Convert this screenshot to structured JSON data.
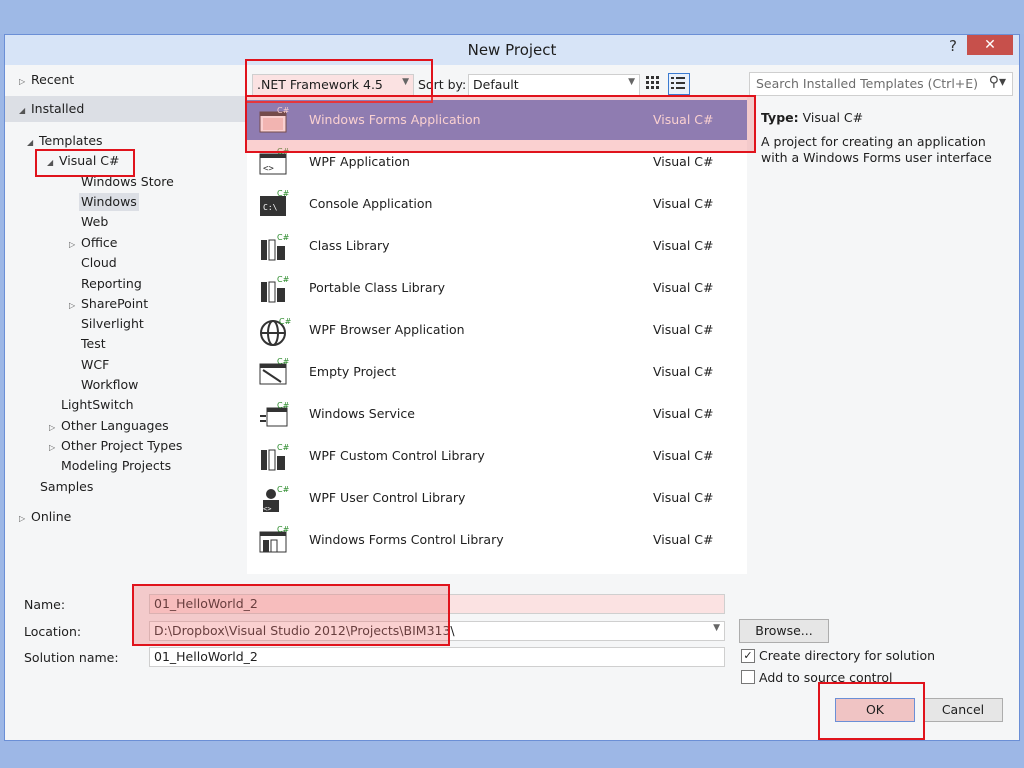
{
  "dialog": {
    "title": "New Project",
    "help": "?",
    "close": "✕"
  },
  "tree": {
    "recent": "Recent",
    "installed": "Installed",
    "templates": "Templates",
    "visual_csharp": "Visual C#",
    "children": [
      "Windows Store",
      "Windows",
      "Web",
      "Office",
      "Cloud",
      "Reporting",
      "SharePoint",
      "Silverlight",
      "Test",
      "WCF",
      "Workflow"
    ],
    "lightswitch": "LightSwitch",
    "other_languages": "Other Languages",
    "other_project_types": "Other Project Types",
    "modeling_projects": "Modeling Projects",
    "samples": "Samples",
    "online": "Online"
  },
  "toolbar": {
    "framework": ".NET Framework 4.5",
    "sort_label": "Sort by:",
    "sort_value": "Default"
  },
  "templates": [
    {
      "name": "Windows Forms Application",
      "lang": "Visual C#",
      "icon": "windows-forms-icon"
    },
    {
      "name": "WPF Application",
      "lang": "Visual C#",
      "icon": "wpf-app-icon"
    },
    {
      "name": "Console Application",
      "lang": "Visual C#",
      "icon": "console-icon"
    },
    {
      "name": "Class Library",
      "lang": "Visual C#",
      "icon": "class-library-icon"
    },
    {
      "name": "Portable Class Library",
      "lang": "Visual C#",
      "icon": "portable-class-library-icon"
    },
    {
      "name": "WPF Browser Application",
      "lang": "Visual C#",
      "icon": "globe-icon"
    },
    {
      "name": "Empty Project",
      "lang": "Visual C#",
      "icon": "empty-project-icon"
    },
    {
      "name": "Windows Service",
      "lang": "Visual C#",
      "icon": "windows-service-icon"
    },
    {
      "name": "WPF Custom Control Library",
      "lang": "Visual C#",
      "icon": "custom-control-icon"
    },
    {
      "name": "WPF User Control Library",
      "lang": "Visual C#",
      "icon": "user-control-icon"
    },
    {
      "name": "Windows Forms Control Library",
      "lang": "Visual C#",
      "icon": "forms-control-icon"
    }
  ],
  "search": {
    "placeholder": "Search Installed Templates (Ctrl+E)"
  },
  "details": {
    "type_label": "Type:",
    "type_value": "Visual C#",
    "description": "A project for creating an application with a Windows Forms user interface"
  },
  "form": {
    "name_label": "Name:",
    "name_value": "01_HelloWorld_2",
    "location_label": "Location:",
    "location_value": "D:\\Dropbox\\Visual Studio 2012\\Projects\\BIM313\\",
    "solution_label": "Solution name:",
    "solution_value": "01_HelloWorld_2",
    "browse": "Browse...",
    "create_dir": "Create directory for solution",
    "create_dir_checked": true,
    "source_control": "Add to source control",
    "source_control_checked": false,
    "ok": "OK",
    "cancel": "Cancel"
  },
  "colors": {
    "selection": "#5b7fd0",
    "annotation": "#e0131c",
    "title_bar": "#d7e4f7"
  }
}
